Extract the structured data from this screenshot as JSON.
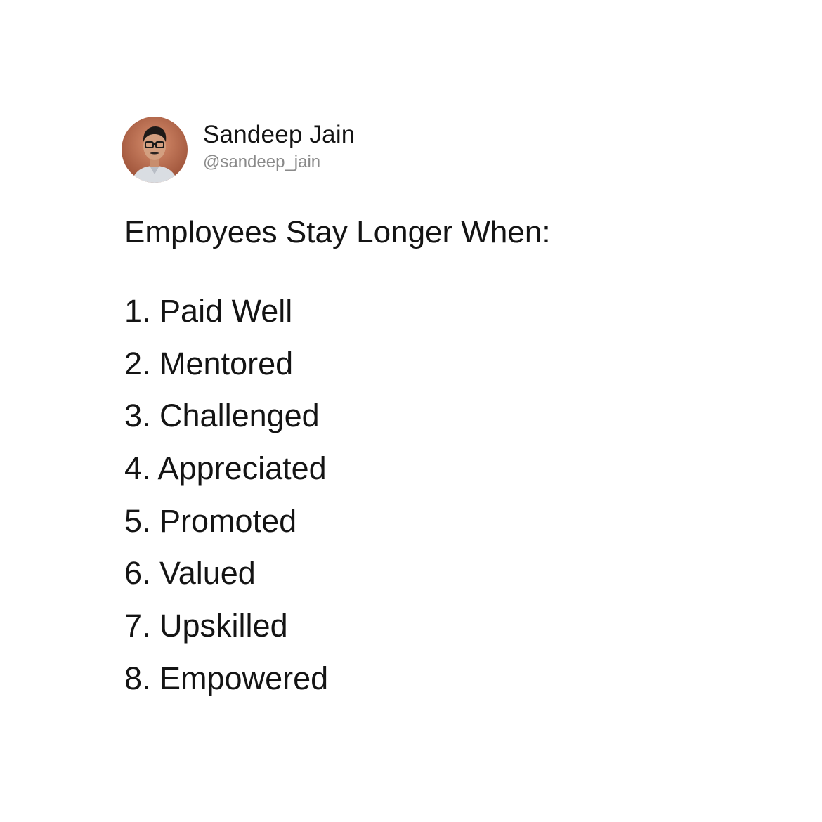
{
  "author": {
    "name": "Sandeep Jain",
    "handle": "@sandeep_jain"
  },
  "post": {
    "headline": "Employees Stay Longer When:",
    "items": [
      "1. Paid Well",
      "2. Mentored",
      "3. Challenged",
      "4. Appreciated",
      "5. Promoted",
      "6. Valued",
      "7. Upskilled",
      "8. Empowered"
    ]
  },
  "colors": {
    "background": "#ffffff",
    "text": "#141414",
    "handle": "#8a8a8a",
    "avatar_background": "#b4664a"
  }
}
